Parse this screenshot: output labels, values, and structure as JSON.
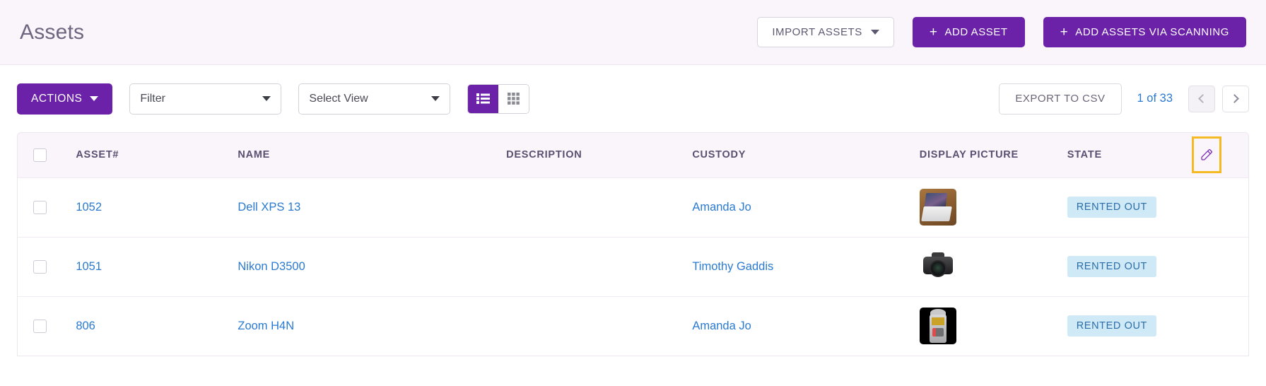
{
  "header": {
    "title": "Assets",
    "import_button": {
      "label": "IMPORT ASSETS",
      "icon": "chevron-down-icon"
    },
    "add_asset_button": {
      "plus": "+",
      "label": "ADD ASSET"
    },
    "add_scanning_button": {
      "plus": "+",
      "label": "ADD ASSETS VIA SCANNING"
    }
  },
  "toolbar": {
    "actions_button": "ACTIONS",
    "filter_select": {
      "value": "Filter"
    },
    "view_select": {
      "value": "Select View"
    },
    "view_toggle": {
      "list_icon": "list-view-icon",
      "grid_icon": "grid-view-icon",
      "active": "list"
    },
    "export_button": "EXPORT TO CSV",
    "pagination": {
      "current": "1",
      "of": " of ",
      "total": "33",
      "text": "1 of 33",
      "prev_icon": "chevron-left-icon",
      "next_icon": "chevron-right-icon",
      "prev_disabled": true
    }
  },
  "table": {
    "columns": [
      {
        "key": "check",
        "label": ""
      },
      {
        "key": "asset",
        "label": "ASSET#"
      },
      {
        "key": "name",
        "label": "NAME"
      },
      {
        "key": "description",
        "label": "DESCRIPTION"
      },
      {
        "key": "custody",
        "label": "CUSTODY"
      },
      {
        "key": "picture",
        "label": "DISPLAY PICTURE"
      },
      {
        "key": "state",
        "label": "STATE"
      },
      {
        "key": "edit",
        "label": ""
      }
    ],
    "edit_columns_icon": "pencil-edit-icon",
    "rows": [
      {
        "asset": "1052",
        "name": "Dell XPS 13",
        "description": "",
        "custody": "Amanda Jo",
        "picture": "laptop-on-desk-thumbnail",
        "state": "RENTED OUT"
      },
      {
        "asset": "1051",
        "name": "Nikon D3500",
        "description": "",
        "custody": "Timothy Gaddis",
        "picture": "dslr-camera-thumbnail",
        "state": "RENTED OUT"
      },
      {
        "asset": "806",
        "name": "Zoom H4N",
        "description": "",
        "custody": "Amanda Jo",
        "picture": "audio-recorder-thumbnail",
        "state": "RENTED OUT"
      }
    ]
  },
  "colors": {
    "brand_purple": "#6b21a8",
    "header_bg": "#faf5fb",
    "link_blue": "#2a7ad1",
    "badge_bg": "#cfe9f7",
    "badge_text": "#2b6ea8",
    "highlight_yellow": "#f5b923"
  }
}
